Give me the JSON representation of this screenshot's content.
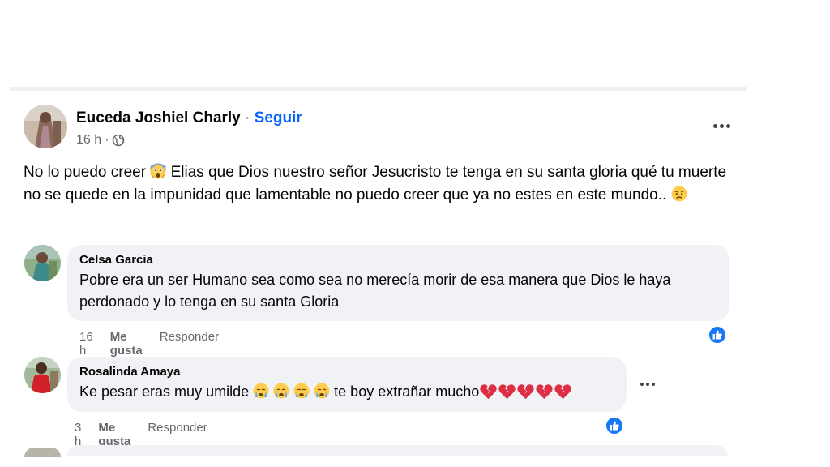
{
  "post": {
    "author": "Euceda Joshiel Charly",
    "separator": "·",
    "follow_label": "Seguir",
    "time": "16 h",
    "meta_sep": "·",
    "text_1": "No lo puedo creer",
    "text_2": "Elias que Dios nuestro señor Jesucristo te tenga en su santa gloria qué tu muerte no se quede en la impunidad que lamentable no puedo creer que ya no estes en este mundo..",
    "icons": [
      "globe-icon",
      "more-options-icon",
      "screaming-face-emoji",
      "sad-face-emoji"
    ]
  },
  "comments": [
    {
      "name": "Celsa Garcia",
      "text": "Pobre era un ser Humano sea como sea no merecía morir de esa manera que Dios le haya perdonado y lo tenga en su santa Gloria",
      "time": "16 h",
      "like_label": "Me gusta",
      "reply_label": "Responder"
    },
    {
      "name": "Rosalinda Amaya",
      "text_1": "Ke pesar eras muy umilde",
      "text_2": "te boy extrañar mucho",
      "time": "3 h",
      "like_label": "Me gusta",
      "reply_label": "Responder"
    }
  ],
  "colors": {
    "link_blue": "#0866ff",
    "like_blue": "#1877f2",
    "bubble_bg": "#f0f2f5",
    "muted_text": "#65676b",
    "heart_red": "#e0245e"
  }
}
